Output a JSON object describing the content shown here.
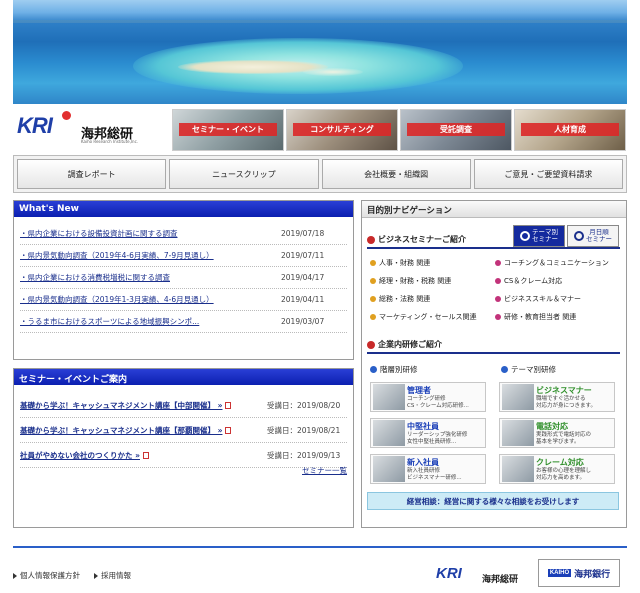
{
  "header": {
    "logo_mark": "KRI",
    "logo_name": "海邦総研",
    "logo_sub": "Kaiho Research Institute,Inc."
  },
  "banners": [
    "セミナー・イベント",
    "コンサルティング",
    "受託調査",
    "人材育成"
  ],
  "nav": [
    "調査レポート",
    "ニュースクリップ",
    "会社概要・組織図",
    "ご意見・ご要望資料請求"
  ],
  "whats_new": {
    "title": "What's New",
    "items": [
      {
        "text": "・県内企業における設備投資計画に関する調査",
        "date": "2019/07/18"
      },
      {
        "text": "・県内景気動向調査（2019年4-6月実績、7-9月見通し）",
        "date": "2019/07/11"
      },
      {
        "text": "・県内企業における消費税増税に関する調査",
        "date": "2019/04/17"
      },
      {
        "text": "・県内景気動向調査（2019年1-3月実績、4-6月見通し）",
        "date": "2019/04/11"
      },
      {
        "text": "・うるま市におけるスポーツによる地域振興シンポ...",
        "date": "2019/03/07"
      }
    ]
  },
  "seminar": {
    "title": "セミナー・イベントご案内",
    "items": [
      {
        "text": "基礎から学ぶ！キャッシュマネジメント講座【中部開催】 »",
        "date": "受講日：2019/08/20"
      },
      {
        "text": "基礎から学ぶ！キャッシュマネジメント講座【那覇開催】 »",
        "date": "受講日：2019/08/21"
      },
      {
        "text": "社員がやめない会社のつくりかた »",
        "date": "受講日：2019/09/13"
      }
    ],
    "more": "セミナー一覧"
  },
  "purpose_nav": {
    "title": "目的別ナビゲーション",
    "business_seminar": "ビジネスセミナーご紹介",
    "tab_theme": "テーマ別\nセミナー",
    "tab_month": "月日順\nセミナー",
    "categories_left": [
      "人事・財務 関連",
      "経理・財務・税務 関連",
      "総務・法務 関連",
      "マーケティング・セールス関連"
    ],
    "categories_right": [
      "コーチング＆コミュニケーション",
      "CS＆クレーム対応",
      "ビジネススキル＆マナー",
      "研修・教育担当者 関連"
    ],
    "training": "企業内研修ご紹介",
    "by_level": "階層別研修",
    "by_theme": "テーマ別研修",
    "cards_left": [
      {
        "title": "管理者",
        "desc": "コーチング研修\nCS・クレーム対応研修..."
      },
      {
        "title": "中堅社員",
        "desc": "リーダーシップ強化研修\n女性中堅社員研修..."
      },
      {
        "title": "新入社員",
        "desc": "新入社員研修\nビジネスマナー研修..."
      }
    ],
    "cards_right": [
      {
        "title": "ビジネスマナー",
        "desc": "職場ですぐ活かせる\n対応力が身につきます。"
      },
      {
        "title": "電話対応",
        "desc": "実践形式で電話対応の\n基本を学びます。"
      },
      {
        "title": "クレーム対応",
        "desc": "お客様の心理を理解し\n対応力を高めます。"
      }
    ],
    "consult": "経営相談：経営に関する様々な相談をお受けします"
  },
  "footer": {
    "links": [
      "個人情報保護方針",
      "採用情報"
    ],
    "logo_mark": "KRI",
    "logo_name": "海邦総研",
    "bank_mark": "KAIHO",
    "bank_name": "海邦銀行"
  },
  "colors": {
    "accent": "#0b1fb0",
    "link": "#1a2f8c",
    "red": "#c82a2a"
  }
}
